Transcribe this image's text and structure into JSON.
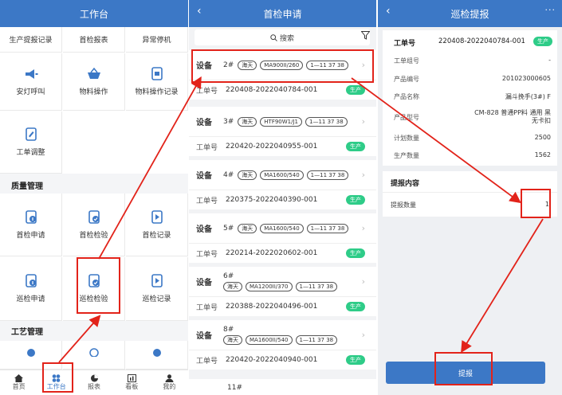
{
  "panel1": {
    "title": "工作台",
    "top_partial": [
      "生产提报记录",
      "首检报表",
      "异常停机"
    ],
    "row1": [
      {
        "label": "安灯呼叫",
        "icon": "megaphone-icon"
      },
      {
        "label": "物料操作",
        "icon": "basket-icon"
      },
      {
        "label": "物料操作记录",
        "icon": "document-icon"
      }
    ],
    "row2": [
      {
        "label": "工单调整",
        "icon": "edit-document-icon"
      }
    ],
    "quality": {
      "title": "质量管理",
      "items": [
        {
          "label": "首检申请",
          "icon": "doc-info-icon"
        },
        {
          "label": "首检检验",
          "icon": "doc-check-icon"
        },
        {
          "label": "首检记录",
          "icon": "doc-record-icon"
        },
        {
          "label": "巡检申请",
          "icon": "doc-info-icon"
        },
        {
          "label": "巡检检验",
          "icon": "doc-check-icon"
        },
        {
          "label": "巡检记录",
          "icon": "doc-record-icon"
        }
      ]
    },
    "process": {
      "title": "工艺管理"
    },
    "tabs": [
      {
        "label": "首页",
        "icon": "home-icon"
      },
      {
        "label": "工作台",
        "icon": "grid-icon"
      },
      {
        "label": "报表",
        "icon": "pie-icon"
      },
      {
        "label": "看板",
        "icon": "board-icon"
      },
      {
        "label": "我的",
        "icon": "user-icon"
      }
    ]
  },
  "panel2": {
    "title": "首检申请",
    "search_placeholder": "搜索",
    "equip_label": "设备",
    "order_label": "工单号",
    "cards": [
      {
        "no": "2#",
        "tags": [
          "海天",
          "MA900II/260",
          "1—11 37 38"
        ],
        "order": "220408-2022040784-001",
        "status": "生产"
      },
      {
        "no": "3#",
        "tags": [
          "海天",
          "HTF90W1/J1",
          "1—11 37 38"
        ],
        "order": "220420-2022040955-001",
        "status": "生产"
      },
      {
        "no": "4#",
        "tags": [
          "海天",
          "MA1600/540",
          "1—11 37 38"
        ],
        "order": "220375-2022040390-001",
        "status": "生产"
      },
      {
        "no": "5#",
        "tags": [
          "海天",
          "MA1600/540",
          "1—11 37 38"
        ],
        "order": "220214-2022020602-001",
        "status": "生产"
      },
      {
        "no": "6#",
        "tags": [
          "海天",
          "MA1200II/370",
          "1—11 37 38"
        ],
        "order": "220388-2022040496-001",
        "status": "生产"
      },
      {
        "no": "8#",
        "tags": [
          "海天",
          "MA1600II/540",
          "1—11 37 38"
        ],
        "order": "220420-2022040940-001",
        "status": "生产"
      }
    ],
    "partial_next": "11#"
  },
  "panel3": {
    "title": "巡检提报",
    "more": "···",
    "order_label": "工单号",
    "order_value": "220408-2022040784-001",
    "status": "生产",
    "rows": [
      {
        "k": "工单组号",
        "v": "-"
      },
      {
        "k": "产品编号",
        "v": "201023000605"
      },
      {
        "k": "产品名称",
        "v": "漏斗挽手(3#) F"
      },
      {
        "k": "产品型号",
        "v": "CM-828 普通PP料 通用 黑 无卡扣"
      },
      {
        "k": "计划数量",
        "v": "2500"
      },
      {
        "k": "生产数量",
        "v": "1562"
      }
    ],
    "section_title": "提报内容",
    "qty_label": "提报数量",
    "qty_value": "1",
    "submit_label": "提报"
  }
}
